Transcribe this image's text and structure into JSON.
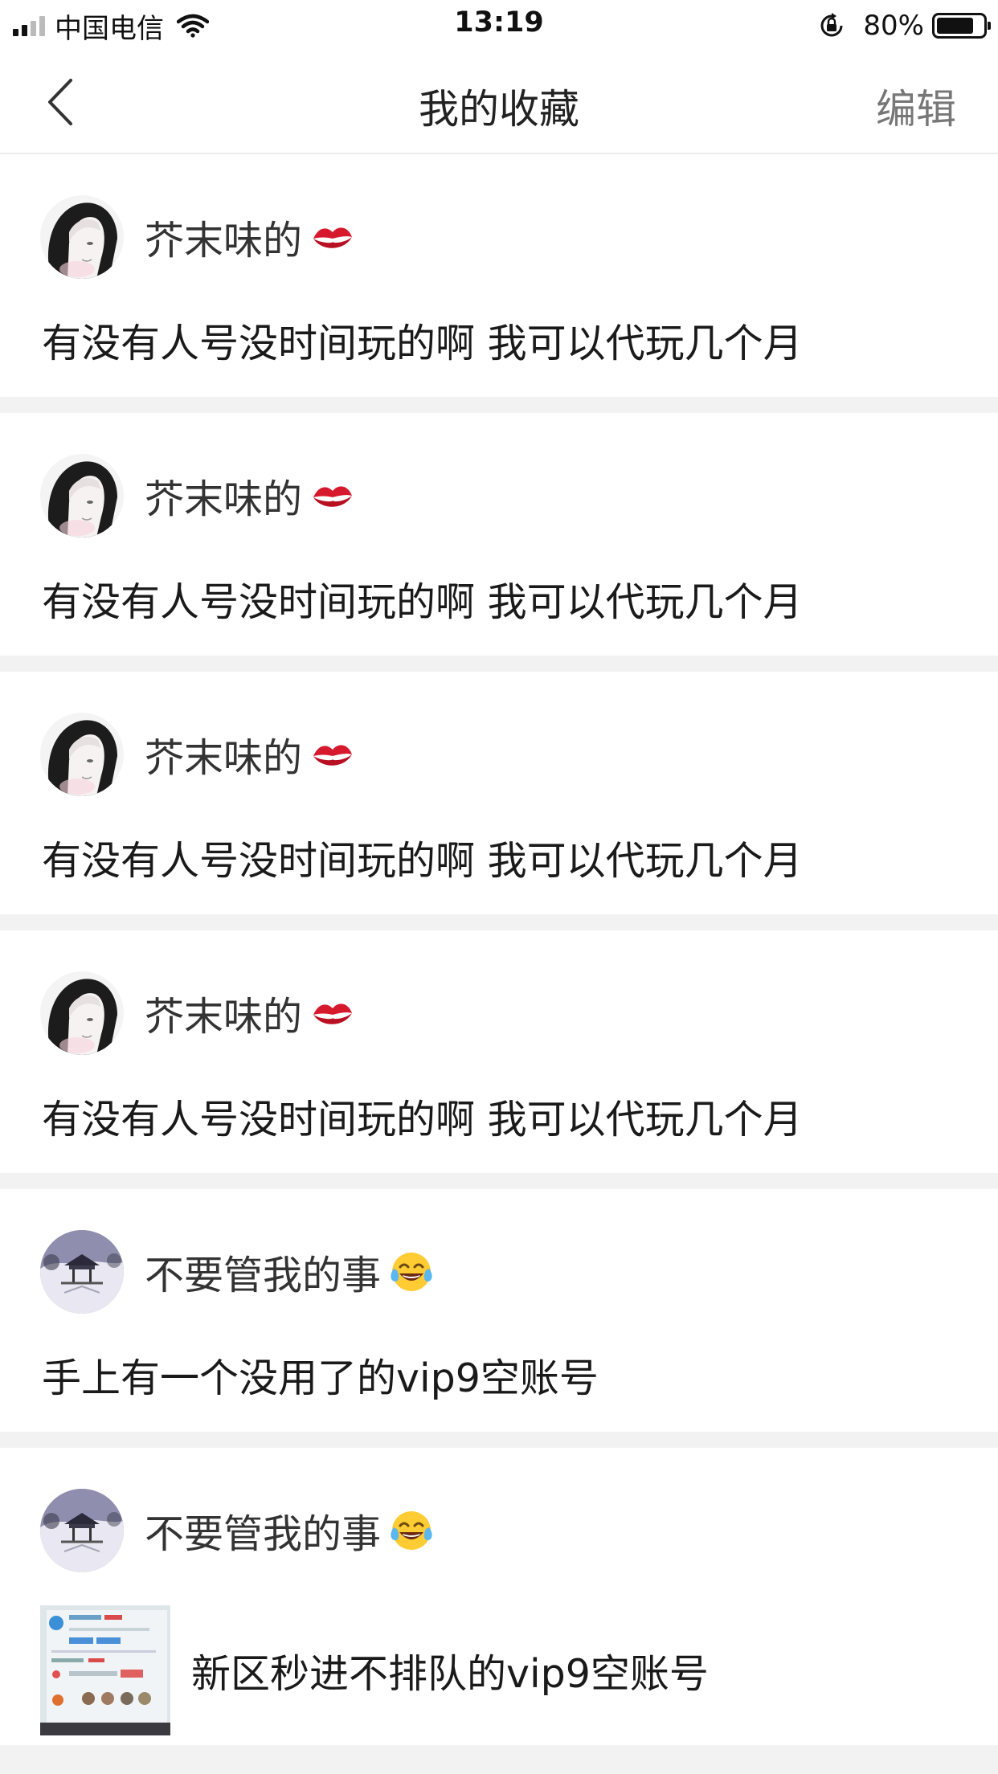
{
  "status_bar": {
    "carrier": "中国电信",
    "time": "13:19",
    "battery_percent": "80%",
    "battery_level": 0.8,
    "signal_bars_active": 2,
    "icons": [
      "signal-icon",
      "wifi-icon",
      "rotation-lock-icon",
      "battery-icon"
    ]
  },
  "nav": {
    "back_icon": "chevron-left-icon",
    "title": "我的收藏",
    "edit_label": "编辑"
  },
  "posts": [
    {
      "username": "芥末味的",
      "emoji": "kiss-mark-icon",
      "avatar": "anime-portrait-avatar",
      "text": "有没有人号没时间玩的啊 我可以代玩几个月"
    },
    {
      "username": "芥末味的",
      "emoji": "kiss-mark-icon",
      "avatar": "anime-portrait-avatar",
      "text": "有没有人号没时间玩的啊 我可以代玩几个月"
    },
    {
      "username": "芥末味的",
      "emoji": "kiss-mark-icon",
      "avatar": "anime-portrait-avatar",
      "text": "有没有人号没时间玩的啊 我可以代玩几个月"
    },
    {
      "username": "芥末味的",
      "emoji": "kiss-mark-icon",
      "avatar": "anime-portrait-avatar",
      "text": "有没有人号没时间玩的啊 我可以代玩几个月"
    },
    {
      "username": "不要管我的事",
      "emoji": "tears-of-joy-icon",
      "avatar": "snowy-pavilion-avatar",
      "text": "手上有一个没用了的vip9空账号"
    },
    {
      "username": "不要管我的事",
      "emoji": "tears-of-joy-icon",
      "avatar": "snowy-pavilion-avatar",
      "text": "新区秒进不排队的vip9空账号",
      "thumbnail": "game-screenshot-thumbnail"
    }
  ]
}
